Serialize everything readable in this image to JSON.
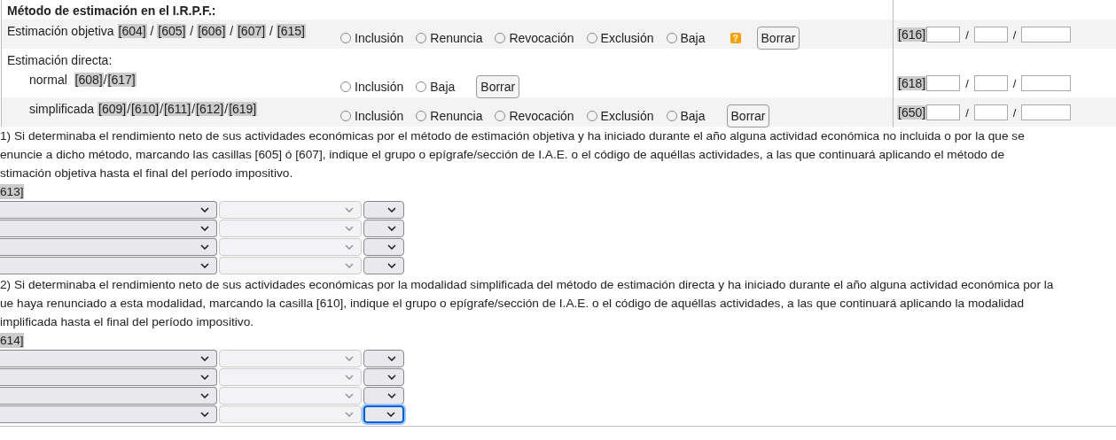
{
  "title": "Método de estimación en el I.R.P.F.:",
  "rows": [
    {
      "label": "Estimación objetiva",
      "separator": " / ",
      "codes": [
        "[604]",
        "[605]",
        "[606]",
        "[607]",
        "[615]"
      ],
      "options": [
        {
          "label": "Inclusión",
          "selected": false
        },
        {
          "label": "Renuncia",
          "selected": false
        },
        {
          "label": "Revocación",
          "selected": false
        },
        {
          "label": "Exclusión",
          "selected": false
        },
        {
          "label": "Baja",
          "selected": false
        }
      ],
      "help": "?",
      "button": "Borrar",
      "right": {
        "code": "[616]",
        "separator": "/"
      }
    },
    {
      "label": "Estimación directa:",
      "children": [
        {
          "label": "normal ",
          "separator": "/",
          "codes": [
            "[608]",
            "[617]"
          ],
          "options": [
            {
              "label": "Inclusión",
              "selected": false
            },
            {
              "label": "Baja",
              "selected": false
            }
          ],
          "button": "Borrar",
          "right": {
            "code": "[618]",
            "separator": "/"
          }
        },
        {
          "label": "simplificada",
          "separator": "/",
          "codes": [
            "[609]",
            "[610]",
            "[611]",
            "[612]",
            "[619]"
          ],
          "options": [
            {
              "label": "Inclusión",
              "selected": false
            },
            {
              "label": "Renuncia",
              "selected": false
            },
            {
              "label": "Revocación",
              "selected": false
            },
            {
              "label": "Exclusión",
              "selected": false
            },
            {
              "label": "Baja",
              "selected": false
            }
          ],
          "button": "Borrar",
          "right": {
            "code": "[650]",
            "separator": "/"
          }
        }
      ]
    }
  ],
  "notes": [
    {
      "lines": [
        "1) Si determinaba el rendimiento neto de sus actividades económicas por el método de estimación objetiva y ha iniciado durante el año alguna actividad económica no incluida o por la que se",
        "enuncie a dicho método, marcando las casillas [605] ó [607], indique el grupo o epígrafe/sección de I.A.E. o el código de aquéllas actividades, a las que continuará aplicando el método de",
        "stimación objetiva hasta el final del período impositivo."
      ],
      "code": "613]",
      "selects": [
        [
          {
            "focused": false
          },
          {
            "focused": false
          },
          {
            "focused": false
          }
        ],
        [
          {
            "focused": false
          },
          {
            "focused": false
          },
          {
            "focused": false
          }
        ],
        [
          {
            "focused": false
          },
          {
            "focused": false
          },
          {
            "focused": false
          }
        ],
        [
          {
            "focused": false
          },
          {
            "focused": false
          },
          {
            "focused": false
          }
        ]
      ]
    },
    {
      "lines": [
        "2) Si determinaba el rendimiento neto de sus actividades económicas por la modalidad simplificada del método de estimación directa y ha iniciado durante el año alguna actividad económica por la",
        "ue haya renunciado a esta modalidad, marcando la casilla [610], indique el grupo o epígrafe/sección de I.A.E. o el código de aquéllas actividades, a las que continuará aplicando la modalidad",
        "implificada hasta el final del período impositivo."
      ],
      "code": "614]",
      "selects": [
        [
          {
            "focused": false
          },
          {
            "focused": false
          },
          {
            "focused": false
          }
        ],
        [
          {
            "focused": false
          },
          {
            "focused": false
          },
          {
            "focused": false
          }
        ],
        [
          {
            "focused": false
          },
          {
            "focused": false
          },
          {
            "focused": false
          }
        ],
        [
          {
            "focused": false
          },
          {
            "focused": false
          },
          {
            "focused": true
          }
        ]
      ]
    }
  ]
}
